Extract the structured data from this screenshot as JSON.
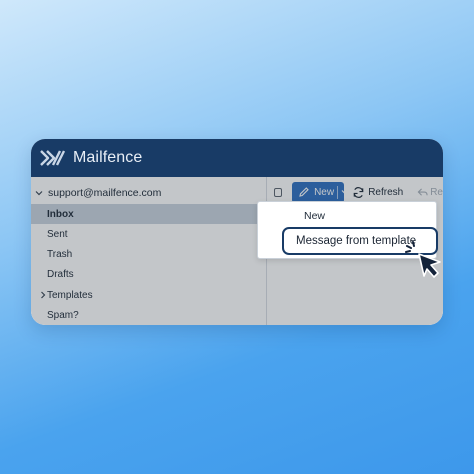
{
  "app": {
    "brand": "Mailfence",
    "logo_icon": "mailfence-logo-icon"
  },
  "sidebar": {
    "account": "support@mailfence.com",
    "items": [
      {
        "label": "Inbox",
        "active": true
      },
      {
        "label": "Sent"
      },
      {
        "label": "Trash"
      },
      {
        "label": "Drafts"
      },
      {
        "label": "Templates",
        "collapsed": true
      },
      {
        "label": "Spam?"
      }
    ]
  },
  "toolbar": {
    "new_label": "New",
    "refresh_label": "Refresh",
    "reply_label": "Re"
  },
  "dropdown": {
    "items": [
      {
        "label": "New"
      },
      {
        "label": "Message from template",
        "highlighted": true
      }
    ]
  },
  "colors": {
    "titlebar": "#183b66",
    "primary_button": "#2f6fc1",
    "active_item": "#cad3de",
    "background_gradient_start": "#cfe8fb",
    "background_gradient_end": "#3d98eb"
  }
}
